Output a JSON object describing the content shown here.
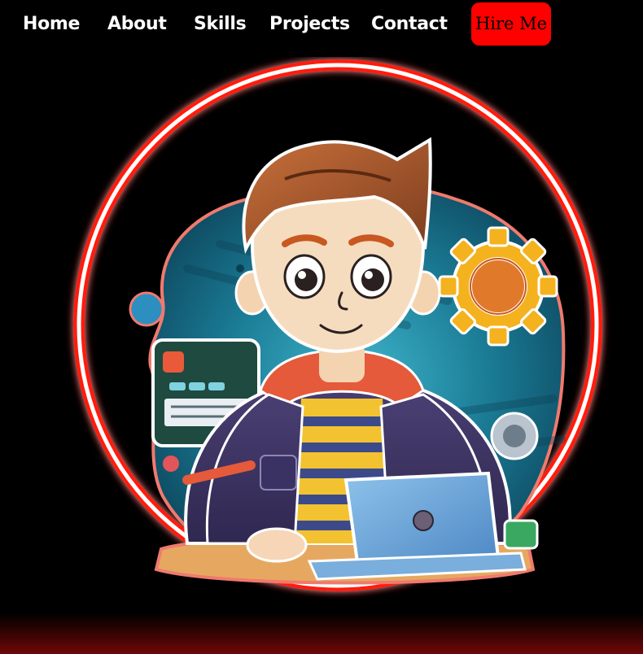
{
  "nav": {
    "items": [
      {
        "label": "Home"
      },
      {
        "label": "About"
      },
      {
        "label": "Skills"
      },
      {
        "label": "Projects"
      },
      {
        "label": "Contact"
      }
    ],
    "cta_label": "Hire Me"
  },
  "hero": {
    "image": "developer-avatar-illustration"
  },
  "colors": {
    "background": "#000000",
    "accent": "#ff0000",
    "nav_text": "#ffffff",
    "ring": "#ff2a1a"
  }
}
